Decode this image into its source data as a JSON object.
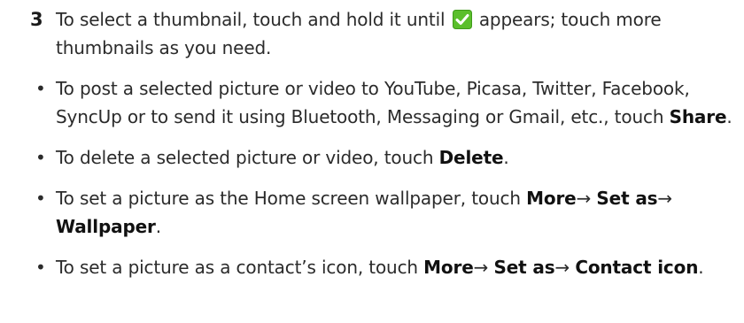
{
  "step": {
    "number": "3",
    "text_before_icon": "To select a thumbnail, touch and hold it until",
    "icon": "checkmark-icon",
    "icon_color": "#5bbf2c",
    "text_after_icon": "appears; touch more thumbnails as you need."
  },
  "bullets": [
    {
      "text": "To post a selected picture or video to YouTube, Picasa, Twitter, Facebook, SyncUp or to send it using Bluetooth, Messaging or Gmail, etc., touch",
      "bold": "Share",
      "end": "."
    },
    {
      "text": "To delete a selected picture or video, touch",
      "bold": "Delete",
      "end": "."
    },
    {
      "text": "To set a picture as the Home screen wallpaper, touch",
      "bold_1": "More",
      "arrow_1": "→",
      "bold_2": "Set as",
      "arrow_2": "→",
      "bold_3": "Wallpaper",
      "end": "."
    },
    {
      "text": "To set a picture as a contact’s icon, touch",
      "bold_1": "More",
      "arrow_1": "→",
      "bold_2": "Set as",
      "arrow_2": "→",
      "bold_3": "Contact icon",
      "end": "."
    }
  ]
}
